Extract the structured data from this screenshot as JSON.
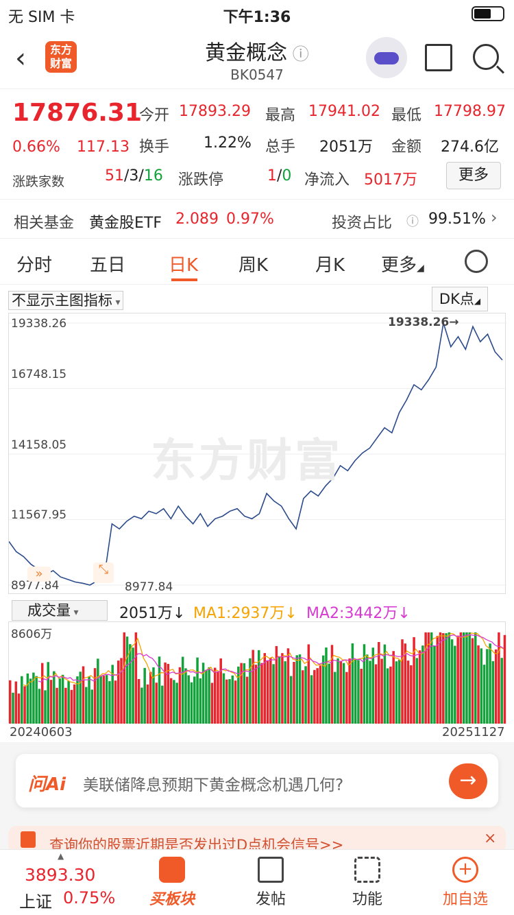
{
  "status_bar": {
    "carrier": "无 SIM 卡",
    "time": "下午1:36"
  },
  "header": {
    "logo_line1": "东方",
    "logo_line2": "财富",
    "title": "黄金概念",
    "code": "BK0547"
  },
  "quote": {
    "price": "17876.31",
    "change_pct": "0.66%",
    "change_amt": "117.13",
    "open_label": "今开",
    "open_value": "17893.29",
    "high_label": "最高",
    "high_value": "17941.02",
    "low_label": "最低",
    "low_value": "17798.97",
    "turnover_label": "换手",
    "turnover_value": "1.22%",
    "volume_label": "总手",
    "volume_value": "2051万",
    "amount_label": "金额",
    "amount_value": "274.6亿",
    "breadth_label": "涨跌家数",
    "breadth_up": "51",
    "breadth_flat": "3",
    "breadth_down": "16",
    "limit_label": "涨跌停",
    "limit_up": "1",
    "limit_down": "0",
    "netflow_label": "净流入",
    "netflow_value": "5017万",
    "more_label": "更多"
  },
  "fund_row": {
    "label": "相关基金",
    "fund_name": "黄金股ETF",
    "fund_price": "2.089",
    "fund_change": "0.97%",
    "ratio_label": "投资占比",
    "ratio_value": "99.51%"
  },
  "tabs": [
    {
      "label": "分时",
      "active": false
    },
    {
      "label": "五日",
      "active": false
    },
    {
      "label": "日K",
      "active": true
    },
    {
      "label": "周K",
      "active": false
    },
    {
      "label": "月K",
      "active": false
    },
    {
      "label": "更多",
      "active": false
    }
  ],
  "chart_controls": {
    "indicator": "不显示主图指标",
    "dk": "DK点"
  },
  "chart_labels": {
    "y_ticks": [
      "19338.26",
      "16748.15",
      "14158.05",
      "11567.95",
      "8977.84"
    ],
    "max_marker": "19338.26→",
    "min_marker": "8977.84",
    "watermark": "东方财富"
  },
  "volume_bar": {
    "selector": "成交量",
    "volume": "2051万↓",
    "ma1": "MA1:2937万↓",
    "ma2": "MA2:3442万↓",
    "max": "8606万",
    "start_date": "20240603",
    "end_date": "20251127"
  },
  "chart_data": {
    "type": "line",
    "ylim": [
      8977.84,
      19338.26
    ],
    "y_ticks": [
      19338.26,
      16748.15,
      14158.05,
      11567.95,
      8977.84
    ],
    "x_range": [
      "20240603",
      "20251127"
    ],
    "close": [
      10700,
      10300,
      10100,
      9800,
      9600,
      9400,
      9550,
      9300,
      9200,
      9100,
      9050,
      8977.84,
      9150,
      9400,
      11400,
      11200,
      11500,
      11700,
      11600,
      11900,
      11800,
      12000,
      11600,
      12100,
      11700,
      11400,
      11800,
      11300,
      11600,
      11700,
      11900,
      12000,
      11700,
      11600,
      11800,
      12600,
      12300,
      12100,
      11600,
      11200,
      12400,
      12700,
      12500,
      12900,
      13200,
      13700,
      13500,
      13900,
      14200,
      14400,
      14800,
      15200,
      15000,
      15800,
      16300,
      16900,
      16700,
      17100,
      17600,
      19338.26,
      18400,
      18800,
      18300,
      19200,
      18600,
      18900,
      18200,
      17876.31
    ],
    "volume_max_wan": 8606,
    "volume_last_wan": 2051,
    "ma1_wan": 2937,
    "ma2_wan": 3442
  },
  "ai_bar": {
    "logo": "问Ai",
    "prompt": "美联储降息预期下黄金概念机遇几何?"
  },
  "notice": {
    "text": "查询你的股票近期是否发出过D点机会信号>>"
  },
  "bottom_nav": {
    "index_value": "3893.30",
    "index_name": "上证",
    "index_change": "0.75%",
    "items": [
      "买板块",
      "发帖",
      "功能",
      "加自选"
    ]
  },
  "colors": {
    "up": "#e8242c",
    "down": "#12a13a",
    "accent": "#f05a28",
    "line": "#2a4a8a",
    "ma1": "#f5a300",
    "ma2": "#d63ad0"
  }
}
